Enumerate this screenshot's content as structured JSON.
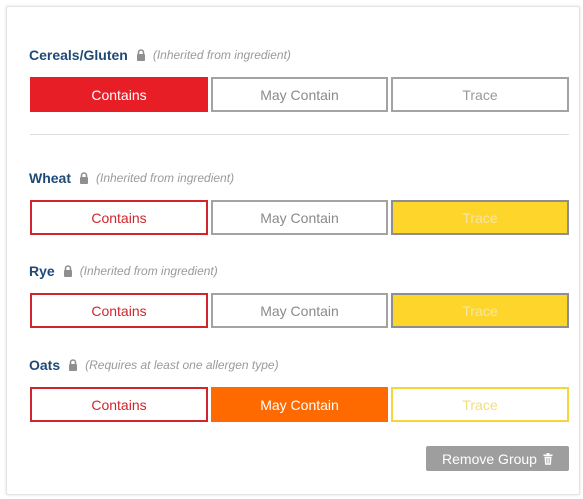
{
  "groups": [
    {
      "name": "Cereals/Gluten",
      "note": "(Inherited from ingredient)",
      "options": {
        "contains": "Contains",
        "may_contain": "May Contain",
        "trace": "Trace"
      },
      "selected": "contains"
    },
    {
      "name": "Wheat",
      "note": "(Inherited from ingredient)",
      "options": {
        "contains": "Contains",
        "may_contain": "May Contain",
        "trace": "Trace"
      },
      "selected": "trace"
    },
    {
      "name": "Rye",
      "note": "(Inherited from ingredient)",
      "options": {
        "contains": "Contains",
        "may_contain": "May Contain",
        "trace": "Trace"
      },
      "selected": "trace"
    },
    {
      "name": "Oats",
      "note": "(Requires at least one allergen type)",
      "options": {
        "contains": "Contains",
        "may_contain": "May Contain",
        "trace": "Trace"
      },
      "selected": "may_contain"
    }
  ],
  "remove_group_label": "Remove Group",
  "icons": {
    "lock": "lock-icon",
    "remove": "trash-icon"
  },
  "colors": {
    "heading": "#1f4a78",
    "contains": "#e81e27",
    "may_contain": "#ff6a00",
    "trace": "#fdd52b",
    "remove_button": "#9e9e9e"
  }
}
